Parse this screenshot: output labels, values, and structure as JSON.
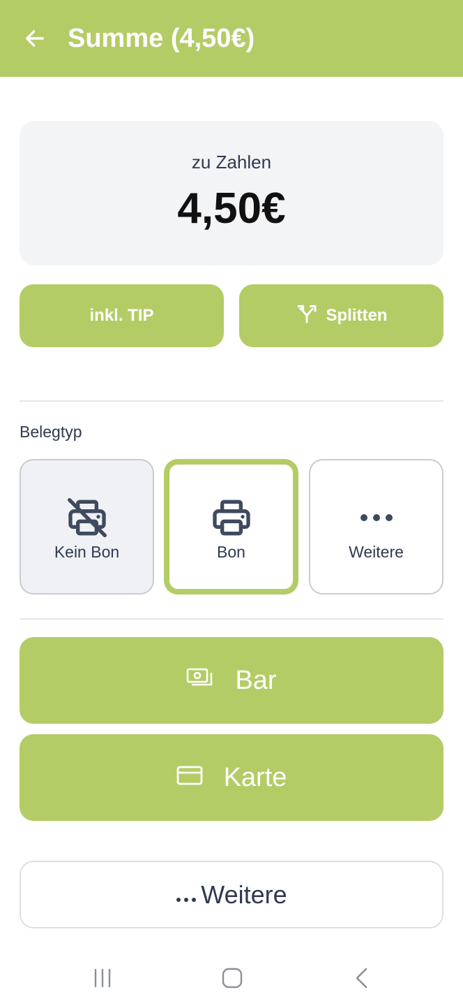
{
  "header": {
    "title": "Summe (4,50€)",
    "back_icon": "arrow-left-icon",
    "color": "#b3cc66"
  },
  "summary": {
    "label": "zu Zahlen",
    "amount": "4,50€"
  },
  "actions": {
    "tip_label": "inkl. TIP",
    "split_label": "Splitten",
    "split_icon": "split-arrows-icon"
  },
  "receipt_type": {
    "label": "Belegtyp",
    "options": [
      {
        "label": "Kein Bon",
        "icon": "printer-off-icon",
        "selected": false
      },
      {
        "label": "Bon",
        "icon": "printer-icon",
        "selected": true
      },
      {
        "label": "Weitere",
        "icon": "more-dots-icon",
        "selected": false
      }
    ]
  },
  "payment": {
    "cash_label": "Bar",
    "cash_icon": "cash-icon",
    "card_label": "Karte",
    "card_icon": "credit-card-icon",
    "more_label": "Weitere",
    "more_icon": "more-dots-icon"
  },
  "system_nav": {
    "recent_icon": "recent-apps-icon",
    "home_icon": "home-icon",
    "back_icon": "nav-back-icon"
  },
  "colors": {
    "accent": "#b3cc66",
    "text": "#2f3a4f",
    "card_bg": "#f3f4f6"
  }
}
